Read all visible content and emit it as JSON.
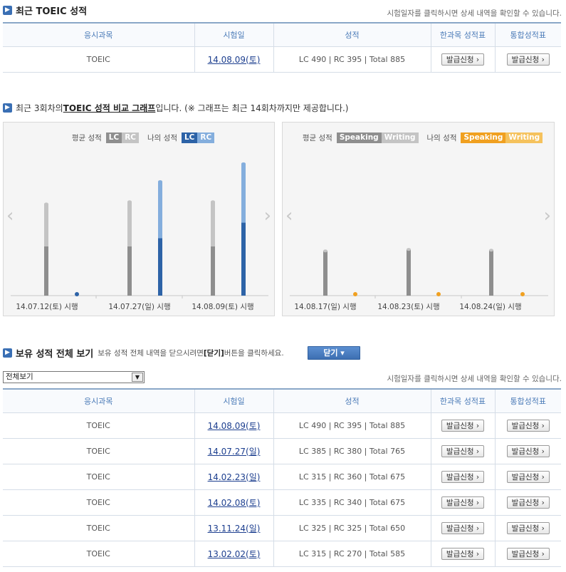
{
  "recent": {
    "title": "최근 TOEIC 성적",
    "hint": "시험일자를 클릭하시면 상세 내역을 확인할 수 있습니다.",
    "headers": [
      "응시과목",
      "시험일",
      "성적",
      "한과목 성적표",
      "통합성적표"
    ],
    "row": {
      "subject": "TOEIC",
      "date": "14.08.09(토)",
      "score": "LC 490 | RC 395 | Total 885",
      "btn1": "발급신청 ›",
      "btn2": "발급신청 ›"
    }
  },
  "compare": {
    "prefix": "최근 3회차의 ",
    "emph": "TOEIC 성적 비교 그래프",
    "suffix": "입니다. (※ 그래프는 최근 14회차까지만 제공합니다.)"
  },
  "legend_lr": {
    "avg": "평균 성적",
    "mine": "나의 성적",
    "lc": "LC",
    "rc": "RC"
  },
  "legend_sw": {
    "avg": "평균 성적",
    "mine": "나의 성적",
    "sp": "Speaking",
    "wr": "Writing"
  },
  "arrows": {
    "prev": "‹",
    "next": "›"
  },
  "colors": {
    "avg_lc": "#8e8e8e",
    "avg_rc": "#c4c4c4",
    "my_lc": "#2d63a7",
    "my_rc": "#84aedd",
    "my_sw": "#f0a020",
    "my_sw_light": "#f5c25d",
    "accent": "#3a6fb4"
  },
  "chart_data": [
    {
      "type": "bar",
      "categories": [
        "14.07.12(토) 시행",
        "14.07.27(일) 시행",
        "14.08.09(토) 시행"
      ],
      "series": [
        {
          "name": "평균 성적 LC",
          "values": [
            330,
            330,
            330
          ]
        },
        {
          "name": "평균 성적 RC",
          "values": [
            285,
            300,
            300
          ]
        },
        {
          "name": "나의 성적 LC",
          "values": [
            0,
            385,
            490
          ]
        },
        {
          "name": "나의 성적 RC",
          "values": [
            0,
            380,
            395
          ]
        }
      ],
      "ylim": [
        0,
        990
      ],
      "stacked": true
    },
    {
      "type": "bar",
      "categories": [
        "14.08.17(일) 시행",
        "14.08.23(토) 시행",
        "14.08.24(일) 시행"
      ],
      "series": [
        {
          "name": "평균 성적 Speaking",
          "values": [
            300,
            310,
            305
          ]
        },
        {
          "name": "나의 성적 Speaking",
          "values": [
            0,
            0,
            0
          ]
        }
      ],
      "ylim": [
        0,
        990
      ],
      "stacked": true
    }
  ],
  "all": {
    "title": "보유 성적 전체 보기",
    "desc": "보유 성적 전체 내역을 닫으시려면 ",
    "desc_bold": "[닫기]",
    "desc_end": " 버튼을 클릭하세요.",
    "close_btn": "닫기  ▾",
    "select": "전체보기",
    "hint": "시험일자를 클릭하시면 상세 내역을 확인할 수 있습니다.",
    "headers": [
      "응시과목",
      "시험일",
      "성적",
      "한과목 성적표",
      "통합성적표"
    ],
    "rows": [
      {
        "subject": "TOEIC",
        "date": "14.08.09(토)",
        "score": "LC 490 | RC 395 | Total 885",
        "btn1": "발급신청 ›",
        "btn2": "발급신청 ›"
      },
      {
        "subject": "TOEIC",
        "date": "14.07.27(일)",
        "score": "LC 385 | RC 380 | Total 765",
        "btn1": "발급신청 ›",
        "btn2": "발급신청 ›"
      },
      {
        "subject": "TOEIC",
        "date": "14.02.23(일)",
        "score": "LC 315 | RC 360 | Total 675",
        "btn1": "발급신청 ›",
        "btn2": "발급신청 ›"
      },
      {
        "subject": "TOEIC",
        "date": "14.02.08(토)",
        "score": "LC 335 | RC 340 | Total 675",
        "btn1": "발급신청 ›",
        "btn2": "발급신청 ›"
      },
      {
        "subject": "TOEIC",
        "date": "13.11.24(일)",
        "score": "LC 325 | RC 325 | Total 650",
        "btn1": "발급신청 ›",
        "btn2": "발급신청 ›"
      },
      {
        "subject": "TOEIC",
        "date": "13.02.02(토)",
        "score": "LC 315 | RC 270 | Total 585",
        "btn1": "발급신청 ›",
        "btn2": "발급신청 ›"
      }
    ]
  }
}
